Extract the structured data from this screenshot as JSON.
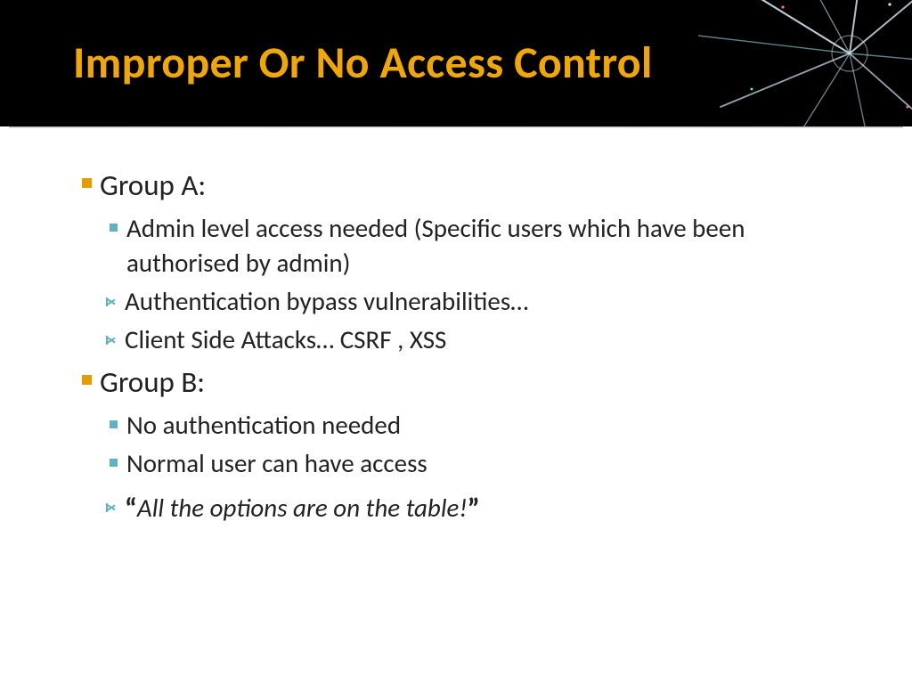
{
  "slide": {
    "title": "Improper Or No Access Control",
    "groupA": {
      "heading": "Group A:",
      "items": [
        {
          "kind": "square",
          "text": "Admin level access needed (Specific users which have been authorised by admin)"
        },
        {
          "kind": "chevron",
          "text": "Authentication bypass vulnerabilities…"
        },
        {
          "kind": "chevron",
          "text": "Client Side Attacks… CSRF , XSS"
        }
      ]
    },
    "groupB": {
      "heading": "Group B:",
      "items": [
        {
          "kind": "square",
          "text": "No authentication needed"
        },
        {
          "kind": "square",
          "text": "Normal user can have access"
        },
        {
          "kind": "chevron",
          "text": "All the options are on the table!",
          "quoted": true
        }
      ]
    }
  }
}
